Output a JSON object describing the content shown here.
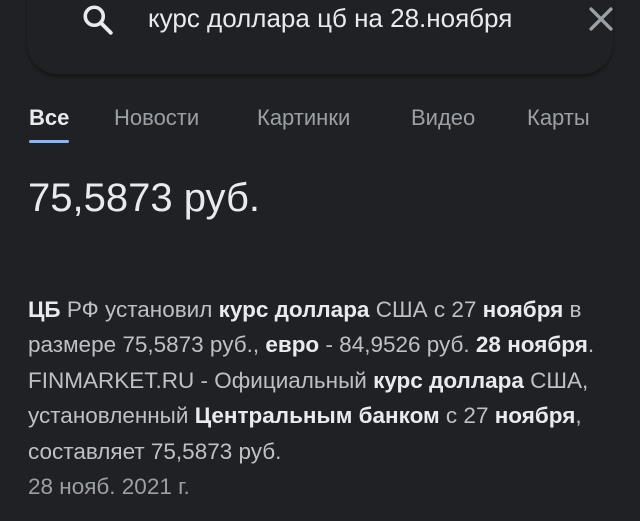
{
  "search": {
    "query": "курс доллара цб на 28.ноября"
  },
  "tabs": [
    {
      "label": "Все",
      "active": true
    },
    {
      "label": "Новости",
      "active": false
    },
    {
      "label": "Картинки",
      "active": false
    },
    {
      "label": "Видео",
      "active": false
    },
    {
      "label": "Карты",
      "active": false
    }
  ],
  "answer": {
    "value": "75,5873 руб."
  },
  "snippet": {
    "parts": [
      {
        "text": "ЦБ",
        "bold": true
      },
      {
        "text": " РФ установил ",
        "bold": false
      },
      {
        "text": "курс доллара",
        "bold": true
      },
      {
        "text": " США с 27 ",
        "bold": false
      },
      {
        "text": "ноября",
        "bold": true
      },
      {
        "text": " в размере 75,5873 руб., ",
        "bold": false
      },
      {
        "text": "евро",
        "bold": true
      },
      {
        "text": " - 84,9526 руб. ",
        "bold": false
      },
      {
        "text": "28 ноября",
        "bold": true
      },
      {
        "text": ". FINMARKET.RU - Официальный ",
        "bold": false
      },
      {
        "text": "курс доллара",
        "bold": true
      },
      {
        "text": " США, установленный ",
        "bold": false
      },
      {
        "text": "Центральным банком",
        "bold": true
      },
      {
        "text": " с 27 ",
        "bold": false
      },
      {
        "text": "ноября",
        "bold": true
      },
      {
        "text": ", составляет 75,5873 руб.",
        "bold": false
      }
    ],
    "date": "28 нояб. 2021 г."
  },
  "icons": {
    "search": "search-icon",
    "clear": "close-icon"
  },
  "colors": {
    "background": "#202124",
    "text_primary": "#e8eaed",
    "text_secondary": "#9aa0a6",
    "accent": "#8ab4f8"
  }
}
